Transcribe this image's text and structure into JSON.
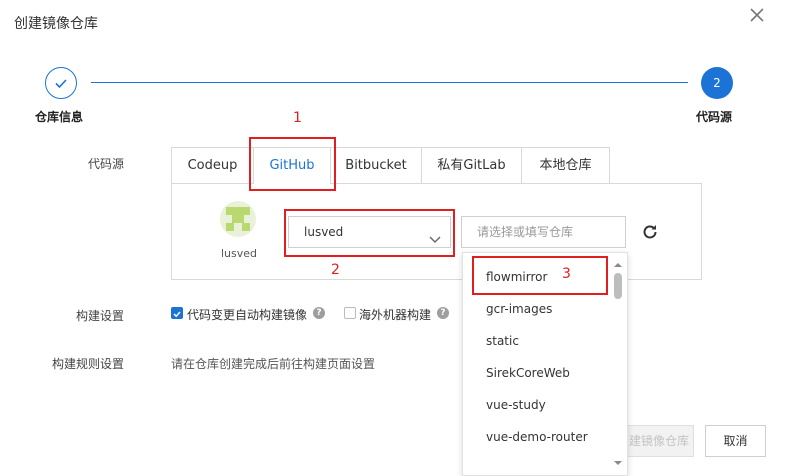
{
  "dialog": {
    "title": "创建镜像仓库"
  },
  "steps": [
    {
      "label": "仓库信息",
      "number": ""
    },
    {
      "label": "代码源",
      "number": "2"
    }
  ],
  "annotations": {
    "a1": "1",
    "a2": "2",
    "a3": "3"
  },
  "source": {
    "label": "代码源",
    "tabs": [
      "Codeup",
      "GitHub",
      "Bitbucket",
      "私有GitLab",
      "本地仓库"
    ],
    "active_tab": "GitHub",
    "account_name": "lusved",
    "org_select_value": "lusved",
    "repo_placeholder": "请选择或填写仓库",
    "repo_options": [
      "flowmirror",
      "gcr-images",
      "static",
      "SirekCoreWeb",
      "vue-study",
      "vue-demo-router"
    ]
  },
  "build_settings": {
    "label": "构建设置",
    "auto_build_label": "代码变更自动构建镜像",
    "auto_build_checked": true,
    "overseas_label": "海外机器构建",
    "overseas_checked": false
  },
  "build_rules": {
    "label": "构建规则设置",
    "text": "请在仓库创建完成后前往构建页面设置"
  },
  "footer": {
    "create_label": "创建镜像仓库",
    "create_visible_text": "建镜像仓库",
    "cancel_label": "取消"
  },
  "colors": {
    "accent": "#1b73d6",
    "annotation": "#e02020"
  }
}
